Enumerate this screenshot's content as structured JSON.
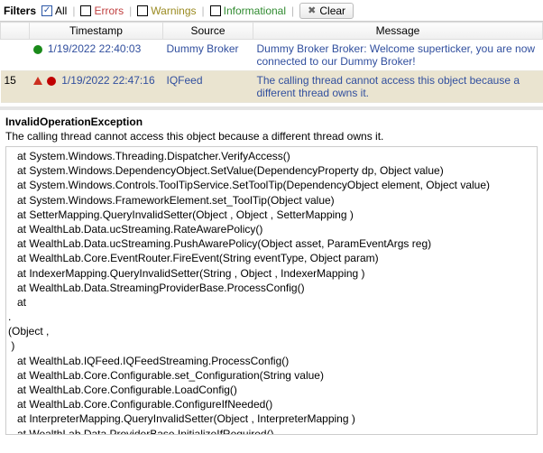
{
  "toolbar": {
    "filters_label": "Filters",
    "all": "All",
    "errors": "Errors",
    "warnings": "Warnings",
    "informational": "Informational",
    "clear": "Clear"
  },
  "columns": {
    "timestamp": "Timestamp",
    "source": "Source",
    "message": "Message"
  },
  "rows": [
    {
      "idx": "",
      "timestamp": "1/19/2022 22:40:03",
      "source": "Dummy Broker",
      "message": "Dummy Broker Broker: Welcome superticker, you are now connected to our Dummy Broker!"
    },
    {
      "idx": "15",
      "timestamp": "1/19/2022 22:47:16",
      "source": "IQFeed",
      "message": "The calling thread cannot access this object because a different thread owns it."
    }
  ],
  "detail": {
    "title": "InvalidOperationException",
    "description": "The calling thread cannot access this object because a different thread owns it.",
    "stack": "   at System.Windows.Threading.Dispatcher.VerifyAccess()\n   at System.Windows.DependencyObject.SetValue(DependencyProperty dp, Object value)\n   at System.Windows.Controls.ToolTipService.SetToolTip(DependencyObject element, Object value)\n   at System.Windows.FrameworkElement.set_ToolTip(Object value)\n   at SetterMapping.QueryInvalidSetter(Object , Object , SetterMapping )\n   at WealthLab.Data.ucStreaming.RateAwarePolicy()\n   at WealthLab.Data.ucStreaming.PushAwarePolicy(Object asset, ParamEventArgs reg)\n   at WealthLab.Core.EventRouter.FireEvent(String eventType, Object param)\n   at IndexerMapping.QueryInvalidSetter(String , Object , IndexerMapping )\n   at WealthLab.Data.StreamingProviderBase.ProcessConfig()\n   at \n.\n(Object ,\n )\n   at WealthLab.IQFeed.IQFeedStreaming.ProcessConfig()\n   at WealthLab.Core.Configurable.set_Configuration(String value)\n   at WealthLab.Core.Configurable.LoadConfig()\n   at WealthLab.Core.Configurable.ConfigureIfNeeded()\n   at InterpreterMapping.QueryInvalidSetter(Object , InterpreterMapping )\n   at WealthLab.Data.ProviderBase.InitializeIfRequired()\n   at WealthLab.Data.StreamingProviderBase.ConnectStreaming()"
  }
}
